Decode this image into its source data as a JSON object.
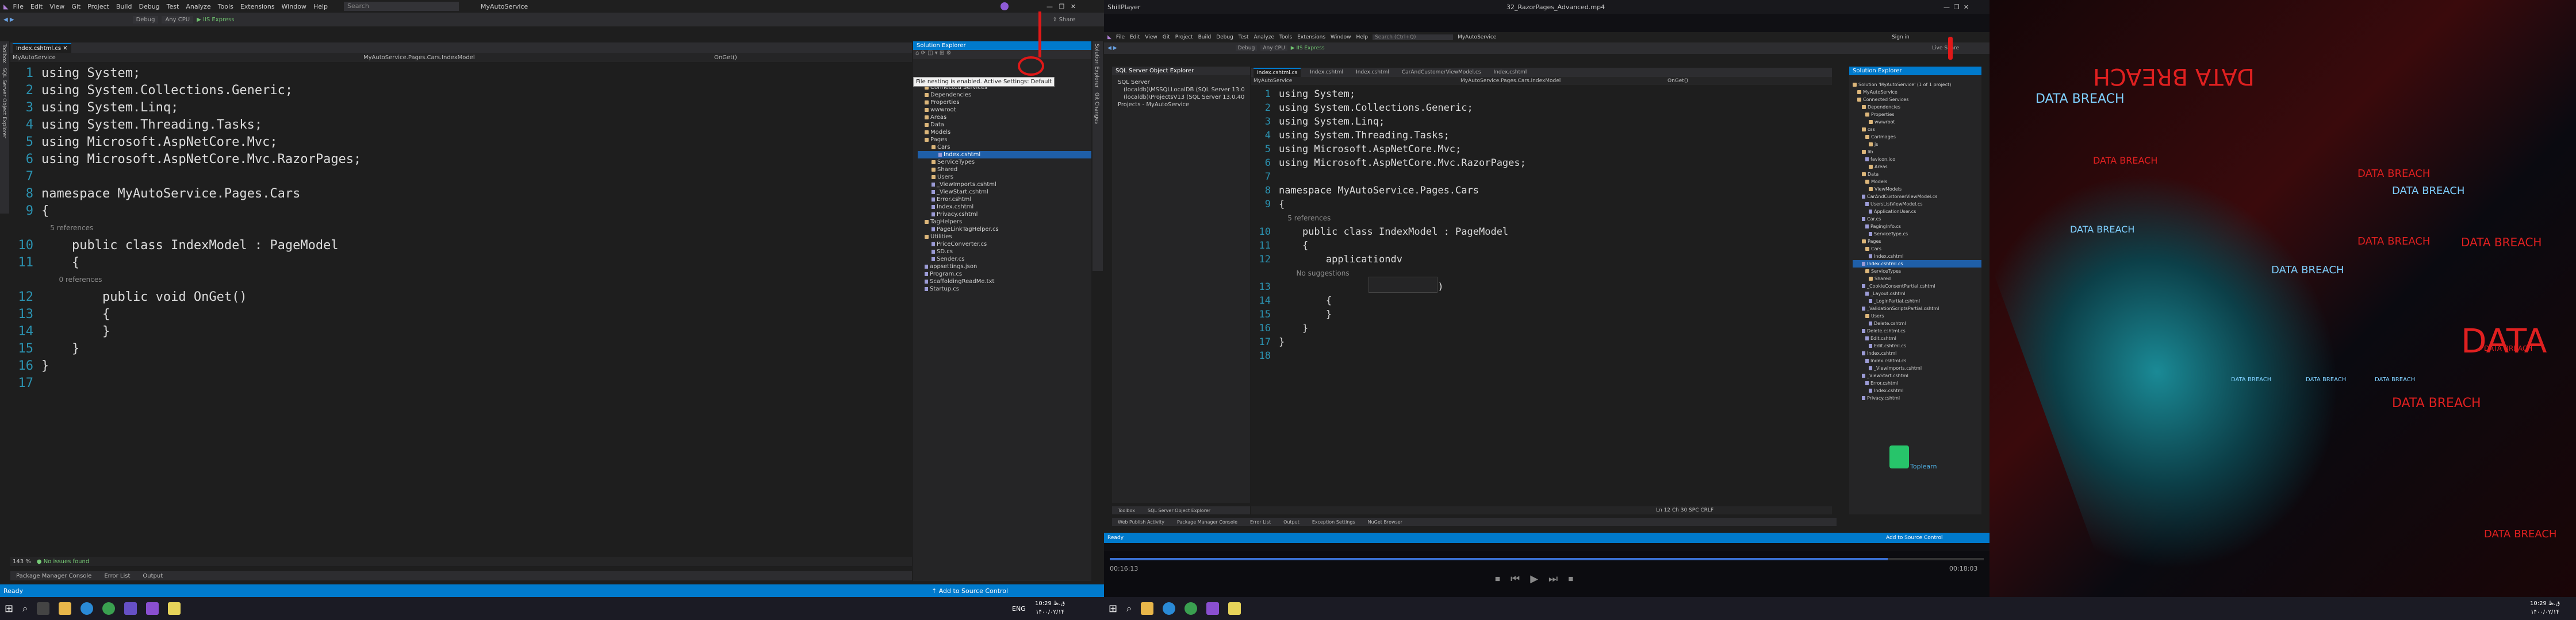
{
  "left": {
    "menu": [
      "File",
      "Edit",
      "View",
      "Git",
      "Project",
      "Build",
      "Debug",
      "Test",
      "Analyze",
      "Tools",
      "Extensions",
      "Window",
      "Help"
    ],
    "search_placeholder": "Search",
    "app_title": "MyAutoService",
    "toolbar": {
      "config": "Debug",
      "platform": "Any CPU",
      "run": "IIS Express",
      "share": "Share"
    },
    "tab": "Index.cshtml.cs",
    "nav_project": "MyAutoService",
    "nav_class": "MyAutoService.Pages.Cars.IndexModel",
    "nav_member": "OnGet()",
    "side_tabs": [
      "Toolbox",
      "SQL Server Object Explorer"
    ],
    "code": [
      {
        "n": "1",
        "t": "using System;"
      },
      {
        "n": "2",
        "t": "using System.Collections.Generic;"
      },
      {
        "n": "3",
        "t": "using System.Linq;"
      },
      {
        "n": "4",
        "t": "using System.Threading.Tasks;"
      },
      {
        "n": "5",
        "t": "using Microsoft.AspNetCore.Mvc;"
      },
      {
        "n": "6",
        "t": "using Microsoft.AspNetCore.Mvc.RazorPages;"
      },
      {
        "n": "7",
        "t": ""
      },
      {
        "n": "8",
        "t": "namespace MyAutoService.Pages.Cars"
      },
      {
        "n": "9",
        "t": "{"
      },
      {
        "n": "",
        "t": "    5 references"
      },
      {
        "n": "10",
        "t": "    public class IndexModel : PageModel"
      },
      {
        "n": "11",
        "t": "    {"
      },
      {
        "n": "",
        "t": "        0 references"
      },
      {
        "n": "12",
        "t": "        public void OnGet()"
      },
      {
        "n": "13",
        "t": "        {"
      },
      {
        "n": "14",
        "t": "        }"
      },
      {
        "n": "15",
        "t": "    }"
      },
      {
        "n": "16",
        "t": "}"
      },
      {
        "n": "17",
        "t": ""
      }
    ],
    "zoom": "143 %",
    "issues": "No issues found",
    "bottom_tabs": [
      "Package Manager Console",
      "Error List",
      "Output"
    ],
    "status_ready": "Ready",
    "status_source": "Add to Source Control",
    "solution_explorer": {
      "title": "Solution Explorer",
      "tooltip": "File nesting is enabled. Active Settings: Default",
      "items": [
        "MyAutoService",
        "Connected Services",
        "Dependencies",
        "Properties",
        "wwwroot",
        "Areas",
        "Data",
        "Models",
        "Pages",
        "Cars",
        "Index.cshtml",
        "ServiceTypes",
        "Shared",
        "Users",
        "_ViewImports.cshtml",
        "_ViewStart.cshtml",
        "Error.cshtml",
        "Index.cshtml",
        "Privacy.cshtml",
        "TagHelpers",
        "PageLinkTagHelper.cs",
        "Utilities",
        "PriceConverter.cs",
        "SD.cs",
        "Sender.cs",
        "appsettings.json",
        "Program.cs",
        "ScaffoldingReadMe.txt",
        "Startup.cs"
      ]
    },
    "right_side_tabs": [
      "Solution Explorer",
      "Git Changes"
    ]
  },
  "taskbar_left": {
    "lang": "ENG",
    "time": "10:29 ق.ظ",
    "date": "۱۴۰۰/۰۲/۱۴"
  },
  "right": {
    "player_title": "ShillPlayer",
    "file_title": "32_RazorPages_Advanced.mp4",
    "menu": [
      "File",
      "Edit",
      "View",
      "Git",
      "Project",
      "Build",
      "Debug",
      "Test",
      "Analyze",
      "Tools",
      "Extensions",
      "Window",
      "Help"
    ],
    "app_title": "MyAutoService",
    "search_placeholder": "Search (Ctrl+Q)",
    "toolbar": {
      "config": "Debug",
      "platform": "Any CPU",
      "run": "IIS Express"
    },
    "sign_in": "Sign in",
    "live_share": "Live Share",
    "sql_title": "SQL Server Object Explorer",
    "sql_items": [
      "SQL Server",
      "(localdb)\\MSSQLLocalDB (SQL Server 13.0",
      "(localdb)\\ProjectsV13 (SQL Server 13.0.40",
      "Projects - MyAutoService"
    ],
    "tabs": [
      "Index.cshtml.cs",
      "Index.cshtml",
      "Index.cshtml",
      "CarAndCustomerViewModel.cs",
      "Index.cshtml"
    ],
    "nav_project": "MyAutoService",
    "nav_class": "MyAutoService.Pages.Cars.IndexModel",
    "nav_member": "OnGet()",
    "code": [
      {
        "n": "1",
        "t": "using System;"
      },
      {
        "n": "2",
        "t": "using System.Collections.Generic;"
      },
      {
        "n": "3",
        "t": "using System.Linq;"
      },
      {
        "n": "4",
        "t": "using System.Threading.Tasks;"
      },
      {
        "n": "5",
        "t": "using Microsoft.AspNetCore.Mvc;"
      },
      {
        "n": "6",
        "t": "using Microsoft.AspNetCore.Mvc.RazorPages;"
      },
      {
        "n": "7",
        "t": ""
      },
      {
        "n": "8",
        "t": "namespace MyAutoService.Pages.Cars"
      },
      {
        "n": "9",
        "t": "{"
      },
      {
        "n": "",
        "t": "    5 references"
      },
      {
        "n": "10",
        "t": "    public class IndexModel : PageModel"
      },
      {
        "n": "11",
        "t": "    {"
      },
      {
        "n": "12",
        "t": "        applicationdv"
      },
      {
        "n": "",
        "t": "        No suggestions"
      },
      {
        "n": "13",
        "t": "                         t()"
      },
      {
        "n": "14",
        "t": "        {"
      },
      {
        "n": "15",
        "t": "        }"
      },
      {
        "n": "16",
        "t": "    }"
      },
      {
        "n": "17",
        "t": "}"
      },
      {
        "n": "18",
        "t": ""
      }
    ],
    "solution_explorer": {
      "title": "Solution Explorer",
      "items": [
        "Solution 'MyAutoService' (1 of 1 project)",
        "MyAutoService",
        "Connected Services",
        "Dependencies",
        "Properties",
        "wwwroot",
        "css",
        "Carlmages",
        "js",
        "lib",
        "favicon.ico",
        "Areas",
        "Data",
        "Models",
        "ViewModels",
        "CarAndCustomerViewModel.cs",
        "UsersListViewModel.cs",
        "ApplicationUser.cs",
        "Car.cs",
        "PagingInfo.cs",
        "ServiceType.cs",
        "Pages",
        "Cars",
        "Index.cshtml",
        "Index.cshtml.cs",
        "ServiceTypes",
        "Shared",
        "_CookieConsentPartial.cshtml",
        "_Layout.cshtml",
        "_LoginPartial.cshtml",
        "_ValidationScriptsPartial.cshtml",
        "Users",
        "Delete.cshtml",
        "Delete.cshtml.cs",
        "Edit.cshtml",
        "Edit.cshtml.cs",
        "Index.cshtml",
        "Index.cshtml.cs",
        "_ViewImports.cshtml",
        "_ViewStart.cshtml",
        "Error.cshtml",
        "Index.cshtml",
        "Privacy.cshtml"
      ]
    },
    "bottom_tabs": [
      "Web Publish Activity",
      "Package Manager Console",
      "Error List",
      "Output",
      "Exception Settings",
      "NuGet Browser"
    ],
    "bottom_left_tabs": [
      "Toolbox",
      "SQL Server Object Explorer"
    ],
    "status_ready": "Ready",
    "status_source": "Add to Source Control",
    "pos": "Ln 12   Ch 30   SPC   CRLF",
    "time_left": "00:16:13",
    "time_right": "00:18:03",
    "watermark": "Toplearn"
  },
  "wallpaper_text": [
    "DATA BREACH",
    "DATA BREACH",
    "DATA BREACH",
    "DATA BREACH",
    "DATA BREACH",
    "DATA BREACH",
    "DATA BREACH",
    "DATA BREACH",
    "DATA BREACH",
    "DATA BREACH",
    "DATA",
    "DATA BREACH",
    "DATA BREACH",
    "DATA BREACH",
    "DATA BREACH",
    "DATA BREACH"
  ],
  "taskbar_right": {
    "time": "10:29 ق.ظ",
    "date": "۱۴۰۰/۰۲/۱۴"
  }
}
